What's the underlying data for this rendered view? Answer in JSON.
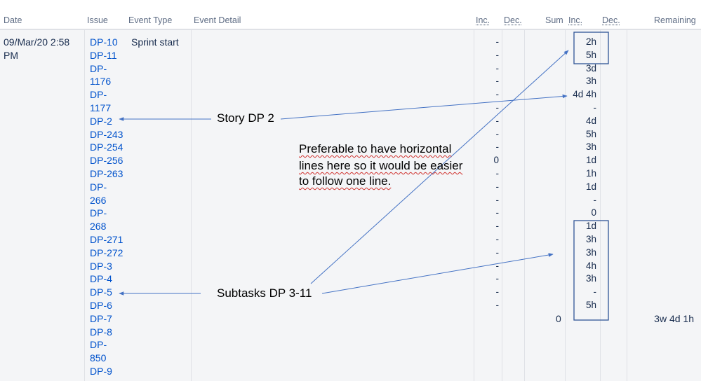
{
  "columns": {
    "date": "Date",
    "issue": "Issue",
    "event_type": "Event Type",
    "event_detail": "Event Detail",
    "inc": "Inc.",
    "dec": "Dec.",
    "sum": "Sum",
    "inc2": "Inc.",
    "dec2": "Dec.",
    "remaining": "Remaining"
  },
  "row": {
    "date_line1": "09/Mar/20 2:58",
    "date_line2": "PM",
    "event_type": "Sprint start",
    "sum_value": "0",
    "remaining": "3w 4d 1h"
  },
  "issues": [
    "DP-10",
    "DP-11",
    "DP-",
    "1176",
    "DP-",
    "1177",
    "DP-2",
    "DP-243",
    "DP-254",
    "DP-256",
    "DP-263",
    "DP-",
    "266",
    "DP-",
    "268",
    "DP-271",
    "DP-272",
    "DP-3",
    "DP-4",
    "DP-5",
    "DP-6",
    "DP-7",
    "DP-8",
    "DP-",
    "850",
    "DP-9"
  ],
  "inc_values": [
    "-",
    "-",
    "-",
    "-",
    "-",
    "-",
    "-",
    "-",
    "-",
    "0",
    "-",
    "-",
    "-",
    "-",
    "-",
    "-",
    "-",
    "-",
    "-",
    "-",
    "-"
  ],
  "estimate_values": [
    "2h",
    "5h",
    "3d",
    "3h",
    "4d 4h",
    "-",
    "4d",
    "5h",
    "3h",
    "1d",
    "1h",
    "1d",
    "-",
    "0",
    "1d",
    "3h",
    "3h",
    "4h",
    "3h",
    "-",
    "5h"
  ],
  "annotations": {
    "story": "Story DP 2",
    "note_line1": "Preferable to have horizontal",
    "note_line2": "lines here so it would be easier",
    "note_line3": "to follow one line.",
    "subtasks": "Subtasks DP 3-11"
  },
  "colors": {
    "link": "#0052cc",
    "arrow": "#4472c4",
    "box": "#2f5597"
  }
}
